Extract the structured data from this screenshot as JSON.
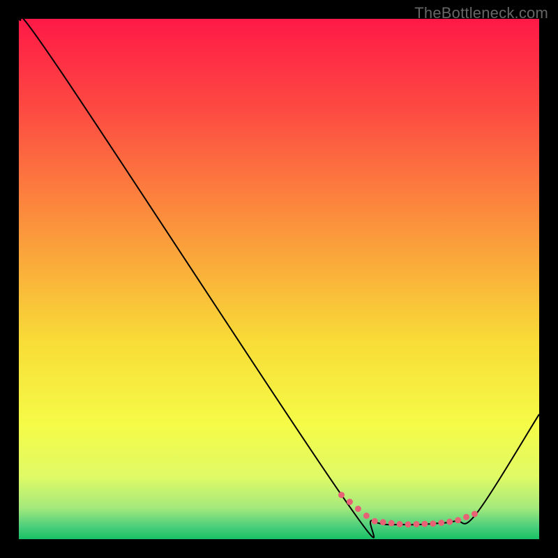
{
  "watermark": "TheBottleneck.com",
  "chart_data": {
    "type": "line",
    "title": "",
    "xlabel": "",
    "ylabel": "",
    "xlim": [
      0,
      100
    ],
    "ylim": [
      0,
      100
    ],
    "grid": false,
    "series": [
      {
        "name": "curve",
        "x": [
          0,
          8,
          62,
          68,
          74,
          80,
          84,
          88,
          100
        ],
        "values": [
          100,
          90,
          8.5,
          3.5,
          2.8,
          3.0,
          3.5,
          5.0,
          24
        ],
        "color": "#000000",
        "marker_color": "#e86275",
        "markers_between_x": [
          62,
          88
        ]
      }
    ],
    "background_gradient": {
      "stops": [
        {
          "offset": 0.0,
          "color": "#fe1946"
        },
        {
          "offset": 0.18,
          "color": "#fd4c42"
        },
        {
          "offset": 0.4,
          "color": "#fb943c"
        },
        {
          "offset": 0.62,
          "color": "#f8dc37"
        },
        {
          "offset": 0.78,
          "color": "#f5fb47"
        },
        {
          "offset": 0.88,
          "color": "#e0fa66"
        },
        {
          "offset": 0.94,
          "color": "#a4e97c"
        },
        {
          "offset": 0.975,
          "color": "#4dcf7c"
        },
        {
          "offset": 1.0,
          "color": "#18c166"
        }
      ]
    }
  }
}
